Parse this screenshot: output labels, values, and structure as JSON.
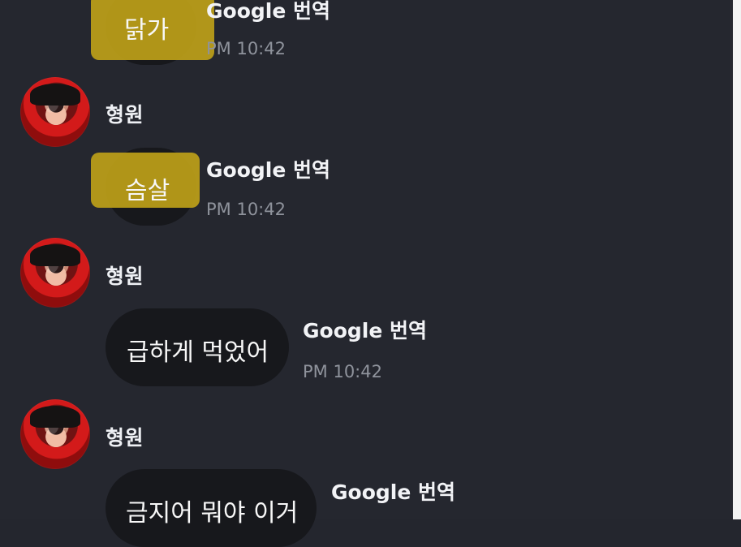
{
  "messages": [
    {
      "text": "닭가",
      "translate": "Google 번역",
      "time": "PM 10:42"
    },
    {
      "sender": "형원",
      "text": "슴살",
      "translate": "Google 번역",
      "time": "PM 10:42"
    },
    {
      "sender": "형원",
      "text": "급하게 먹었어",
      "translate": "Google 번역",
      "time": "PM 10:42"
    },
    {
      "sender": "형원",
      "text": "금지어 뭐야 이거",
      "translate": "Google 번역"
    }
  ],
  "colors": {
    "background": "#25272f",
    "bubble": "#17181c",
    "highlight": "#c1a318",
    "timestamp": "#8f939c"
  },
  "icons": {
    "avatar": "profile-avatar"
  }
}
